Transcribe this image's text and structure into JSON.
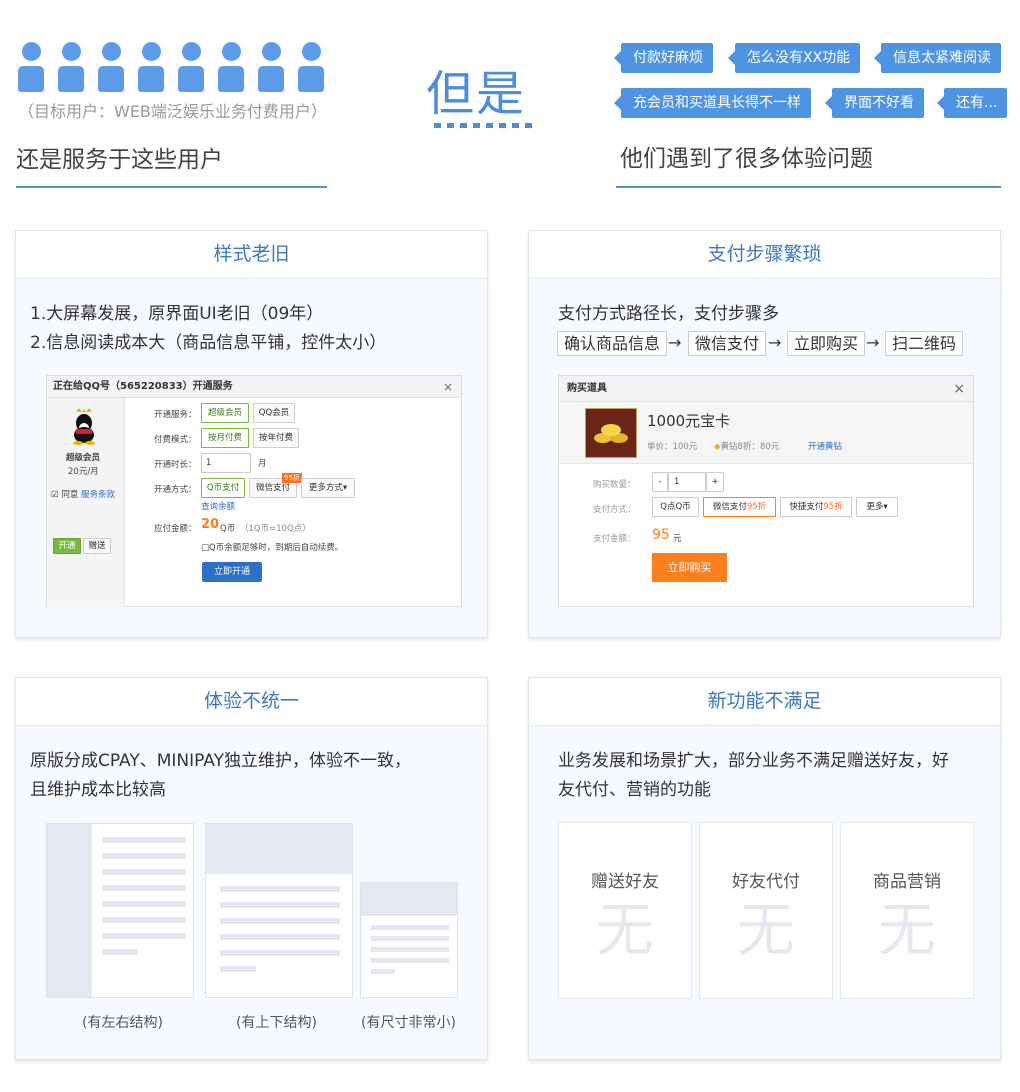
{
  "top": {
    "users_caption": "（目标用户：WEB端泛娱乐业务付费用户）",
    "left_title": "还是服务于这些用户",
    "center": "但是",
    "right_title": "他们遇到了很多体验问题",
    "tags": [
      "付款好麻烦",
      "怎么没有XX功能",
      "信息太紧难阅读",
      "充会员和买道具长得不一样",
      "界面不好看",
      "还有..."
    ]
  },
  "cards": {
    "c1": {
      "title": "样式老旧",
      "lines": [
        "1.大屏幕发展，原界面UI老旧（09年）",
        "2.信息阅读成本大（商品信息平铺，控件太小）"
      ],
      "mock": {
        "title": "正在给QQ号（565220833）开通服务",
        "close": "×",
        "member": "超级会员",
        "price": "20元/月",
        "agree": "同意",
        "terms": "服务条款",
        "tab_open": "开通",
        "tab_gift": "赠送",
        "label_service": "开通服务：",
        "opt_super": "超级会员",
        "opt_qq": "QQ会员",
        "label_mode": "付费模式：",
        "opt_month": "按月付费",
        "opt_year": "按年付费",
        "label_duration": "开通时长：",
        "duration_value": "1",
        "duration_unit": "月",
        "label_method": "开通方式：",
        "opt_qcoin": "Q币支付",
        "opt_wechat": "微信支付",
        "discount": "95折",
        "opt_more": "更多方式",
        "query": "查询余额",
        "label_amount": "应付金额：",
        "amount": "20",
        "amount_unit": "Q币",
        "amount_note": "（1Q币=10Q点）",
        "auto_renew": "Q币余额足够时，到期后自动续费。",
        "submit": "立即开通"
      }
    },
    "c2": {
      "title": "支付步骤繁琐",
      "line": "支付方式路径长，支付步骤多",
      "flow": [
        "确认商品信息",
        "微信支付",
        "立即购买",
        "扫二维码"
      ],
      "arrow": "→",
      "mock": {
        "title": "购买道具",
        "close": "×",
        "product": "1000元宝卡",
        "unit_price_label": "单价：",
        "unit_price": "100元",
        "yellow_diamond": "黄钻8折：",
        "yellow_price": "80元",
        "open_yellow": "开通黄钻",
        "qty_label": "购买数量：",
        "minus": "-",
        "qty": "1",
        "plus": "+",
        "method_label": "支付方式：",
        "m1": "Q点Q币",
        "m2": "微信支付",
        "m2_discount": "95折",
        "m3": "快捷支付",
        "m3_discount": "95折",
        "m4": "更多",
        "amount_label": "支付金额：",
        "amount": "95",
        "amount_unit": "元",
        "buy": "立即购买"
      }
    },
    "c3": {
      "title": "体验不统一",
      "lines": [
        "原版分成CPAY、MINIPAY独立维护，体验不一致，",
        "且维护成本比较高"
      ],
      "captions": [
        "(有左右结构)",
        "(有上下结构)",
        "(有尺寸非常小)"
      ]
    },
    "c4": {
      "title": "新功能不满足",
      "lines": [
        "业务发展和场景扩大，部分业务不满足赠送好友，好",
        "友代付、营销的功能"
      ],
      "features": [
        {
          "name": "赠送好友",
          "value": "无"
        },
        {
          "name": "好友代付",
          "value": "无"
        },
        {
          "name": "商品营销",
          "value": "无"
        }
      ]
    }
  },
  "colors": {
    "accent": "#4f8ed6",
    "tag": "#4f94e0",
    "title": "#3f78bd",
    "orange": "#ff7e1e"
  }
}
